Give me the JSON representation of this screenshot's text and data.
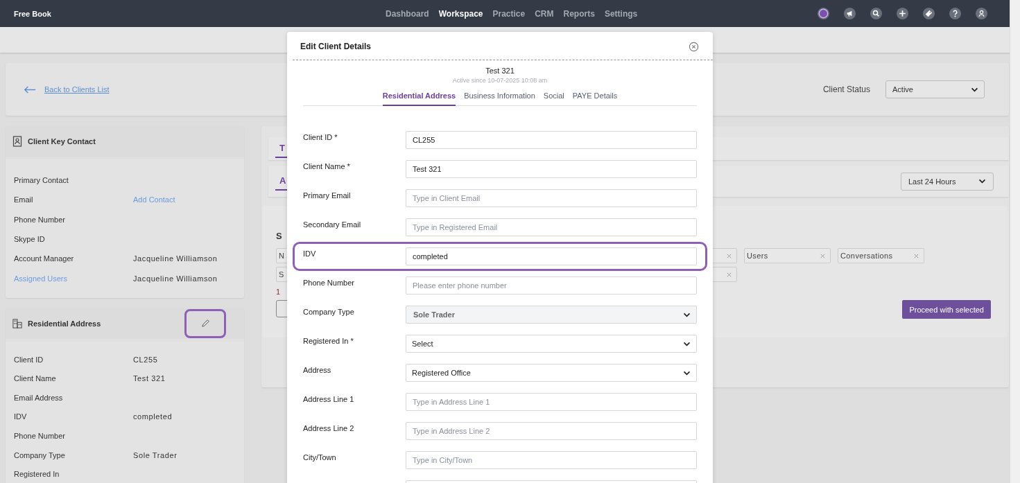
{
  "navbar": {
    "brand": "Free Book",
    "links": [
      {
        "label": "Dashboard",
        "selected": false
      },
      {
        "label": "Workspace",
        "selected": true
      },
      {
        "label": "Practice",
        "selected": false
      },
      {
        "label": "CRM",
        "selected": false
      },
      {
        "label": "Reports",
        "selected": false
      },
      {
        "label": "Settings",
        "selected": false
      }
    ],
    "icons": [
      {
        "kind": "avatar"
      },
      {
        "kind": "megaphone"
      },
      {
        "kind": "search"
      },
      {
        "kind": "plus"
      },
      {
        "kind": "tag"
      },
      {
        "kind": "help"
      },
      {
        "kind": "user"
      }
    ]
  },
  "header": {
    "back_link": "Back to Clients List",
    "status_label": "Client Status",
    "status_value": "Active"
  },
  "key_contact": {
    "title": "Client Key Contact",
    "rows": [
      {
        "label": "Primary Contact",
        "label_link": false
      },
      {
        "label": "Email",
        "label_link": false,
        "value": "Add Contact",
        "value_link": true
      },
      {
        "label": "Phone Number",
        "label_link": false
      },
      {
        "label": "Skype ID",
        "label_link": false
      },
      {
        "label": "Account Manager",
        "label_link": false,
        "value": "Jacqueline Williamson",
        "value_link": false
      },
      {
        "label": "Assigned Users",
        "label_link": true,
        "value": "Jacqueline Williamson",
        "value_link": false
      }
    ]
  },
  "residential": {
    "title": "Residential Address",
    "edit_highlighted": true,
    "rows": [
      {
        "label": "Client ID",
        "value": "CL255"
      },
      {
        "label": "Client Name",
        "value": "Test 321"
      },
      {
        "label": "Email Address"
      },
      {
        "label": "IDV",
        "value": "completed"
      },
      {
        "label": "Phone Number"
      },
      {
        "label": "Company Type",
        "value": "Sole Trader"
      },
      {
        "label": "Registered In"
      }
    ]
  },
  "activity": {
    "tab": "T",
    "subtab": "A",
    "range": "Last 24 Hours",
    "heading": "S",
    "chip_rows": [
      [
        {
          "kind": "tag",
          "label": "N"
        },
        {
          "kind": "covered",
          "removable": true
        },
        {
          "kind": "tag",
          "label": "Users",
          "removable": true
        },
        {
          "kind": "tag",
          "label": "Conversations",
          "removable": true
        }
      ],
      [
        {
          "kind": "tag",
          "label": "S"
        },
        {
          "kind": "covered",
          "removable": true
        }
      ]
    ],
    "note": "1",
    "proceed": "Proceed with selected"
  },
  "modal": {
    "title": "Edit Client Details",
    "client_name": "Test 321",
    "active_since": "Active since 10-07-2025 10:08 am",
    "tabs": [
      {
        "label": "Residential Address",
        "selected": true
      },
      {
        "label": "Business Information",
        "selected": false
      },
      {
        "label": "Social",
        "selected": false
      },
      {
        "label": "PAYE Details",
        "selected": false
      }
    ],
    "fields": [
      {
        "label": "Client ID *",
        "kind": "input",
        "value": "CL255",
        "disabled": false,
        "highlighted": false
      },
      {
        "label": "Client Name *",
        "kind": "input",
        "value": "Test 321",
        "disabled": false,
        "highlighted": false
      },
      {
        "label": "Primary Email",
        "kind": "input",
        "placeholder": "Type in Client Email",
        "disabled": false,
        "highlighted": false
      },
      {
        "label": "Secondary Email",
        "kind": "input",
        "placeholder": "Type in Registered Email",
        "disabled": false,
        "highlighted": false
      },
      {
        "label": "IDV",
        "kind": "input",
        "value": "completed",
        "disabled": false,
        "highlighted": true
      },
      {
        "label": "Phone Number",
        "kind": "input",
        "placeholder": "Please enter phone number",
        "disabled": false,
        "highlighted": false
      },
      {
        "label": "Company Type",
        "kind": "select",
        "value": "Sole Trader",
        "disabled": true,
        "highlighted": false
      },
      {
        "label": "Registered In *",
        "kind": "select",
        "value": "Select",
        "disabled": false,
        "highlighted": false
      },
      {
        "label": "Address",
        "kind": "select",
        "value": "Registered Office",
        "disabled": false,
        "highlighted": false
      },
      {
        "label": "Address Line 1",
        "kind": "input",
        "placeholder": "Type in Address Line 1",
        "disabled": false,
        "highlighted": false
      },
      {
        "label": "Address Line 2",
        "kind": "input",
        "placeholder": "Type in Address Line 2",
        "disabled": false,
        "highlighted": false
      },
      {
        "label": "City/Town",
        "kind": "input",
        "placeholder": "Type in City/Town",
        "disabled": false,
        "highlighted": false
      },
      {
        "kind": "input",
        "disabled": false,
        "highlighted": false
      }
    ]
  }
}
